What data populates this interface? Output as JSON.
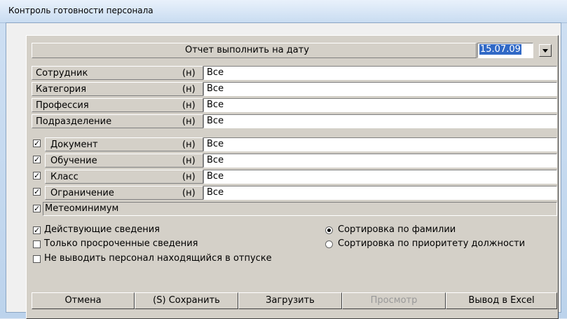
{
  "window": {
    "title": "Контроль готовности персонала"
  },
  "report": {
    "label": "Отчет выполнить на дату",
    "date": "15.07.09"
  },
  "filters": [
    {
      "label": "Сотрудник",
      "marker": "(н)",
      "value": "Все"
    },
    {
      "label": "Категория",
      "marker": "(н)",
      "value": "Все"
    },
    {
      "label": "Профессия",
      "marker": "(н)",
      "value": "Все"
    },
    {
      "label": "Подразделение",
      "marker": "(н)",
      "value": "Все"
    }
  ],
  "checked_filters": [
    {
      "label": "Документ",
      "marker": "(н)",
      "value": "Все",
      "checked": true
    },
    {
      "label": "Обучение",
      "marker": "(н)",
      "value": "Все",
      "checked": true
    },
    {
      "label": "Класс",
      "marker": "(н)",
      "value": "Все",
      "checked": true
    },
    {
      "label": "Ограничение",
      "marker": "(н)",
      "value": "Все",
      "checked": true
    }
  ],
  "meteo": {
    "label": "Метеоминимум",
    "checked": true
  },
  "options": [
    {
      "label": "Действующие сведения",
      "checked": true
    },
    {
      "label": "Только просроченные сведения",
      "checked": false
    },
    {
      "label": "Не выводить персонал находящийся в отпуске",
      "checked": false
    }
  ],
  "sort": [
    {
      "label": "Сортировка по фамилии",
      "selected": true
    },
    {
      "label": "Сортировка по приоритету должности",
      "selected": false
    }
  ],
  "buttons": {
    "cancel": "Отмена",
    "save": "(S) Сохранить",
    "load": "Загрузить",
    "preview": "Просмотр",
    "excel": "Вывод в Excel"
  },
  "icons": {
    "dropdown": "chevron-down-icon"
  }
}
